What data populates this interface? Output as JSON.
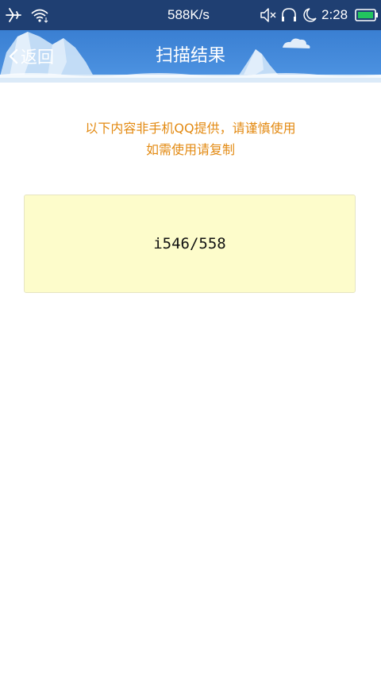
{
  "status_bar": {
    "network_speed": "588K/s",
    "time": "2:28",
    "icons": [
      "airplane-mode-icon",
      "wifi-icon",
      "mute-icon",
      "headphones-icon",
      "moon-icon",
      "battery-icon"
    ],
    "battery_color": "#22c55e"
  },
  "header": {
    "back_label": "返回",
    "title": "扫描结果",
    "background_color": "#3f86d9"
  },
  "notice": {
    "line1": "以下内容非手机QQ提供，请谨慎使用",
    "line2": "如需使用请复制",
    "color": "#e38a12"
  },
  "result": {
    "text": "i546/558",
    "background_color": "#fdfccb"
  }
}
